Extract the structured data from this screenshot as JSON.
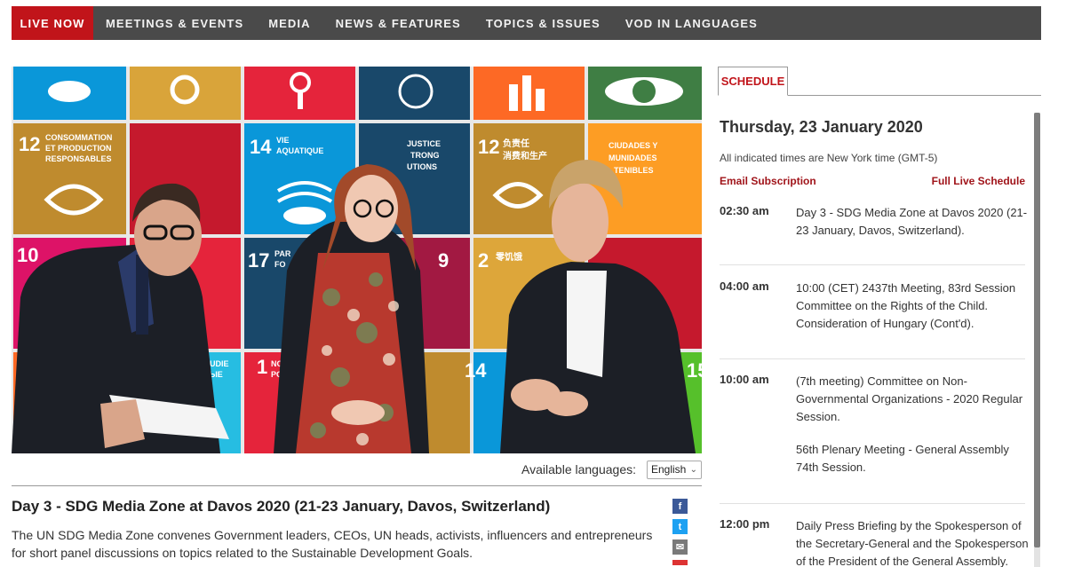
{
  "nav": {
    "items": [
      {
        "label": "LIVE NOW"
      },
      {
        "label": "MEETINGS & EVENTS"
      },
      {
        "label": "MEDIA"
      },
      {
        "label": "NEWS & FEATURES"
      },
      {
        "label": "TOPICS & ISSUES"
      },
      {
        "label": "VOD IN LANGUAGES"
      }
    ]
  },
  "video": {
    "backdrop_tiles": [
      {
        "number": "12",
        "text": "CONSOMMATION ET PRODUCTION RESPONSABLES",
        "color": "#bf8b2e"
      },
      {
        "number": "14",
        "text": "VIE AQUATIQUE",
        "color": "#0a97d9"
      },
      {
        "number": "12",
        "text": "负责任 消费和生产",
        "color": "#bf8b2e"
      },
      {
        "number": "10",
        "text": "",
        "color": "#dd1367"
      },
      {
        "number": "17",
        "text": "PAR",
        "color": "#19486a"
      },
      {
        "number": "1",
        "text": "NO POVERTY",
        "color": "#e5243b"
      },
      {
        "number": "2",
        "text": "零饥饿",
        "color": "#dda63a"
      },
      {
        "number": "14",
        "text": "",
        "color": "#0a97d9"
      },
      {
        "number": "15",
        "text": "",
        "color": "#56c02b"
      }
    ],
    "partial_texts": [
      "JUSTICE",
      "TRONG",
      "UTIONS",
      "CIUDADES Y",
      "MUNIDADES",
      "TENIBLES",
      "OSUDIE",
      "BNЫE",
      "9"
    ]
  },
  "language": {
    "label": "Available languages:",
    "selected": "English"
  },
  "event": {
    "title": "Day 3 - SDG Media Zone at Davos 2020 (21-23 January, Davos, Switzerland)",
    "description": "The UN SDG Media Zone convenes Government leaders, CEOs, UN heads, activists, influencers and entrepreneurs for short panel discussions on topics related to the Sustainable Development Goals."
  },
  "share": {
    "facebook": "f",
    "twitter": "t",
    "email": "✉"
  },
  "schedule": {
    "tab_label": "SCHEDULE",
    "date": "Thursday, 23 January 2020",
    "timezone_note": "All indicated times are New York time (GMT-5)",
    "email_link": "Email Subscription",
    "full_link": "Full Live Schedule",
    "events": [
      {
        "time": "02:30 am",
        "text": "Day 3 - SDG Media Zone at Davos 2020 (21-23 January, Davos, Switzerland)."
      },
      {
        "time": "04:00 am",
        "text": "10:00 (CET) 2437th Meeting, 83rd Session Committee on the Rights of the Child. Consideration of Hungary (Cont'd)."
      },
      {
        "time": "10:00 am",
        "text": "(7th meeting) Committee on Non-Governmental Organizations - 2020 Regular Session.",
        "text2": "56th Plenary Meeting - General Assembly 74th Session."
      },
      {
        "time": "12:00 pm",
        "text": "Daily Press Briefing by the Spokesperson of the Secretary-General and the Spokesperson of the President of the General Assembly."
      }
    ]
  },
  "colors": {
    "accent": "#c1141a",
    "nav_bg": "#4a4a4a",
    "link": "#a0141a"
  }
}
